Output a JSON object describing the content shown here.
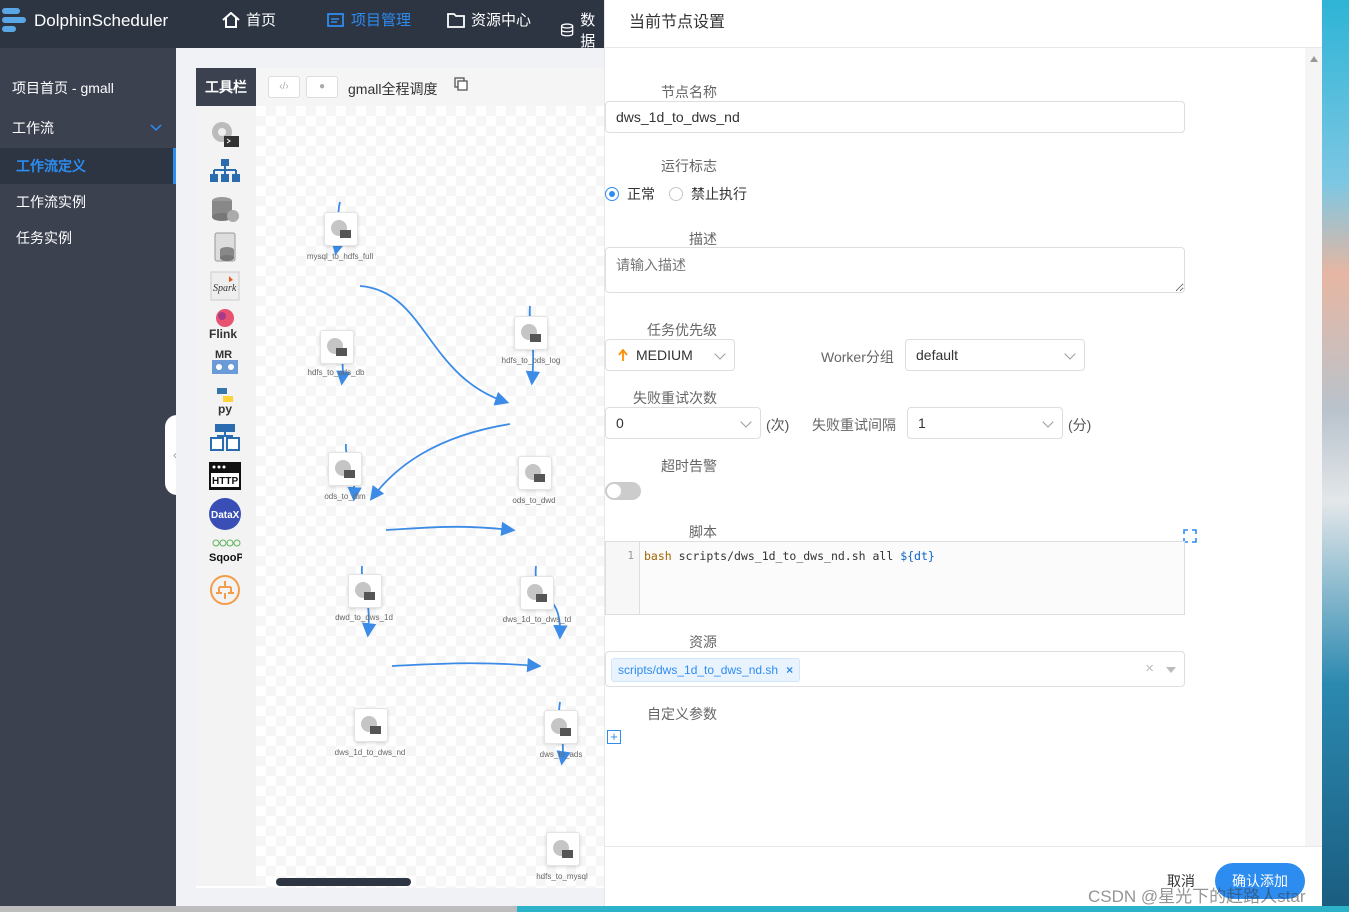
{
  "app": {
    "name": "DolphinScheduler"
  },
  "topnav": [
    {
      "label": "首页",
      "icon": "home-icon",
      "active": false
    },
    {
      "label": "项目管理",
      "icon": "project-icon",
      "active": true
    },
    {
      "label": "资源中心",
      "icon": "folder-icon",
      "active": false
    },
    {
      "label": "数据",
      "icon": "database-icon",
      "active": false
    }
  ],
  "sidebar": {
    "project_home": "项目首页 - gmall",
    "workflow": "工作流",
    "items": [
      {
        "label": "工作流定义",
        "active": true
      },
      {
        "label": "工作流实例",
        "active": false
      },
      {
        "label": "任务实例",
        "active": false
      }
    ]
  },
  "canvas": {
    "toolbar_title": "工具栏",
    "workflow_name": "gmall全程调度",
    "tools": [
      "shell-icon",
      "sub-process-icon",
      "procedure-icon",
      "sql-icon",
      "spark-icon",
      "flink-icon",
      "mr-icon",
      "python-icon",
      "dependent-icon",
      "http-icon",
      "datax-icon",
      "sqoop-icon",
      "conditions-icon"
    ],
    "tool_labels": {
      "spark": "Spark",
      "flink": "Flink",
      "mr": "MR",
      "python": "py",
      "http": "HTTP",
      "datax": "DataX",
      "sqoop": "SqooP"
    },
    "nodes": [
      {
        "id": "n1",
        "label": "mysql_to_hdfs_full"
      },
      {
        "id": "n2",
        "label": "hdfs_to_ods_db"
      },
      {
        "id": "n3",
        "label": "hdfs_to_ods_log"
      },
      {
        "id": "n4",
        "label": "ods_to_dim"
      },
      {
        "id": "n5",
        "label": "ods_to_dwd"
      },
      {
        "id": "n6",
        "label": "dwd_to_dws_1d"
      },
      {
        "id": "n7",
        "label": "dws_1d_to_dws_td"
      },
      {
        "id": "n8",
        "label": "dws_1d_to_dws_nd"
      },
      {
        "id": "n9",
        "label": "dws_to_ads"
      },
      {
        "id": "n10",
        "label": "hdfs_to_mysql"
      }
    ]
  },
  "drawer": {
    "title": "当前节点设置",
    "node_name_label": "节点名称",
    "node_name_value": "dws_1d_to_dws_nd",
    "run_flag_label": "运行标志",
    "run_flag_options": [
      "正常",
      "禁止执行"
    ],
    "run_flag_selected": "正常",
    "desc_label": "描述",
    "desc_placeholder": "请输入描述",
    "priority_label": "任务优先级",
    "priority_value": "MEDIUM",
    "priority_color": "#ff8c00",
    "worker_label": "Worker分组",
    "worker_value": "default",
    "retry_times_label": "失败重试次数",
    "retry_times_value": "0",
    "retry_times_unit": "(次)",
    "retry_interval_label": "失败重试间隔",
    "retry_interval_value": "1",
    "retry_interval_unit": "(分)",
    "timeout_label": "超时告警",
    "timeout_enabled": false,
    "script_label": "脚本",
    "script_line_number": "1",
    "script_keyword": "bash",
    "script_body": " scripts/dws_1d_to_dws_nd.sh all ",
    "script_var": "${dt}",
    "resource_label": "资源",
    "resource_tag": "scripts/dws_1d_to_dws_nd.sh",
    "custom_params_label": "自定义参数",
    "cancel_label": "取消",
    "confirm_label": "确认添加",
    "accent_color": "#2d8cf0"
  },
  "watermark": "CSDN @星光下的赶路人star"
}
